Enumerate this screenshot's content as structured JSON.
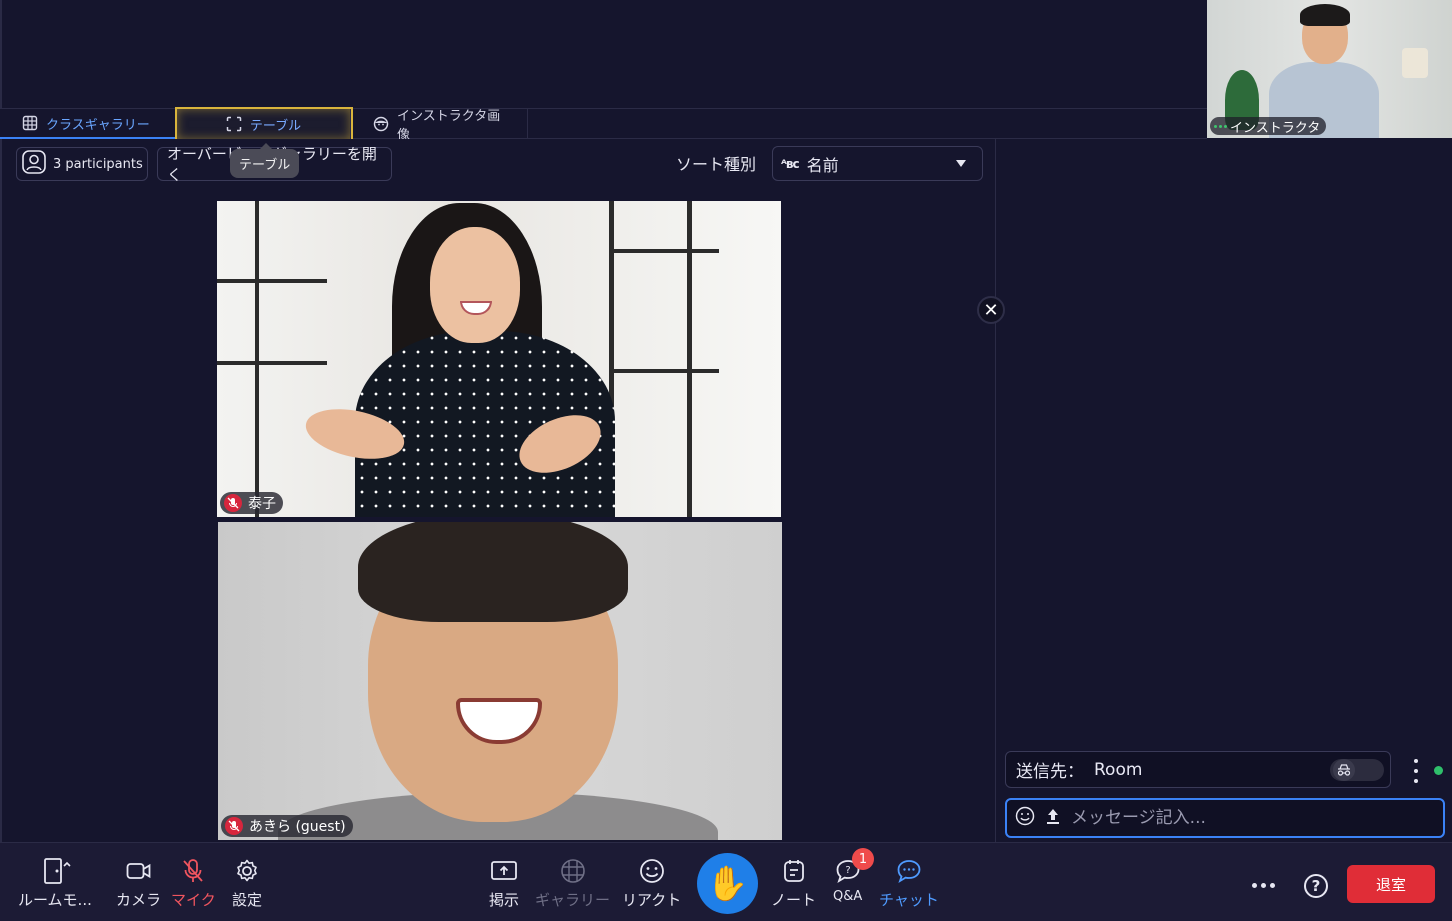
{
  "tabs": [
    {
      "label": "クラスギャラリー"
    },
    {
      "label": "テーブル"
    },
    {
      "label": "インストラクタ画像"
    }
  ],
  "instructor": {
    "label": "インストラクタ"
  },
  "controls": {
    "participants_label": "3 participants",
    "overview_label": "オーバービューギャラリーを開く",
    "tooltip": "テーブル",
    "sort_label": "ソート種別",
    "sort_value": "名前",
    "sort_icon_text": "ᴬʙᴄ"
  },
  "participants": [
    {
      "name": "泰子"
    },
    {
      "name": "あきら (guest)"
    }
  ],
  "chat": {
    "to_label": "送信先：",
    "to_value": "Room",
    "placeholder": "メッセージ記入..."
  },
  "toolbar": {
    "room_mode": "ルームモ...",
    "camera": "カメラ",
    "mic": "マイク",
    "settings": "設定",
    "share": "掲示",
    "gallery": "ギャラリー",
    "react": "リアクト",
    "notes": "ノート",
    "qa": "Q&A",
    "qa_badge": "1",
    "chat": "チャット",
    "leave": "退室"
  },
  "colors": {
    "accent": "#3b82f6",
    "leave": "#e02d37",
    "mic_off": "#d7263d",
    "highlight": "#d9b43c"
  }
}
